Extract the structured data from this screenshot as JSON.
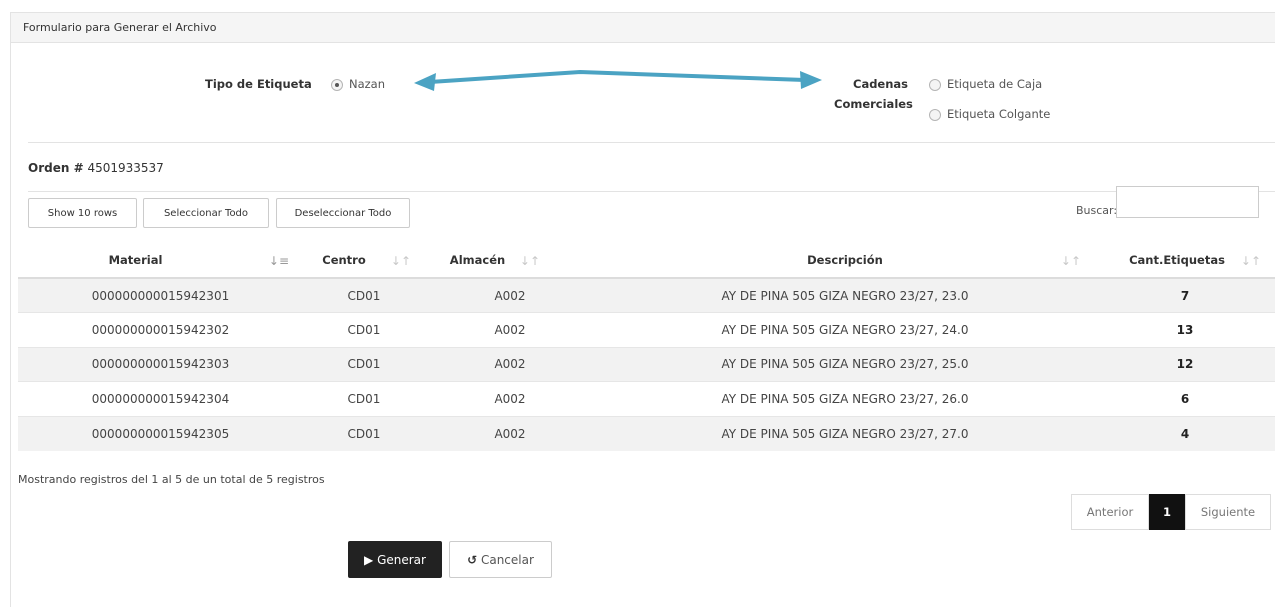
{
  "panel": {
    "title": "Formulario para Generar el Archivo"
  },
  "tipo": {
    "label": "Tipo de Etiqueta",
    "option_nazan": "Nazan",
    "cadenas_label_1": "Cadenas",
    "cadenas_label_2": "Comerciales",
    "option_caja": "Etiqueta de Caja",
    "option_colgante": "Etiqueta Colgante"
  },
  "orden": {
    "label": "Orden #",
    "number": "4501933537"
  },
  "toolbar": {
    "show_rows": "Show 10 rows",
    "select_all": "Seleccionar Todo",
    "deselect_all": "Deseleccionar Todo",
    "search_label": "Buscar:",
    "search_value": ""
  },
  "table": {
    "headers": [
      "Material",
      "Centro",
      "Almacén",
      "Descripción",
      "Cant.Etiquetas"
    ],
    "rows": [
      [
        "000000000015942301",
        "CD01",
        "A002",
        "AY DE PINA 505 GIZA NEGRO 23/27, 23.0",
        "7"
      ],
      [
        "000000000015942302",
        "CD01",
        "A002",
        "AY DE PINA 505 GIZA NEGRO 23/27, 24.0",
        "13"
      ],
      [
        "000000000015942303",
        "CD01",
        "A002",
        "AY DE PINA 505 GIZA NEGRO 23/27, 25.0",
        "12"
      ],
      [
        "000000000015942304",
        "CD01",
        "A002",
        "AY DE PINA 505 GIZA NEGRO 23/27, 26.0",
        "6"
      ],
      [
        "000000000015942305",
        "CD01",
        "A002",
        "AY DE PINA 505 GIZA NEGRO 23/27, 27.0",
        "4"
      ]
    ]
  },
  "footer": {
    "info": "Mostrando registros del 1 al 5 de un total de 5 registros",
    "prev": "Anterior",
    "page": "1",
    "next": "Siguiente"
  },
  "actions": {
    "generate": "Generar",
    "cancel": "Cancelar"
  },
  "colors": {
    "arrow": "#4ba3c3",
    "dark_button": "#222222"
  }
}
